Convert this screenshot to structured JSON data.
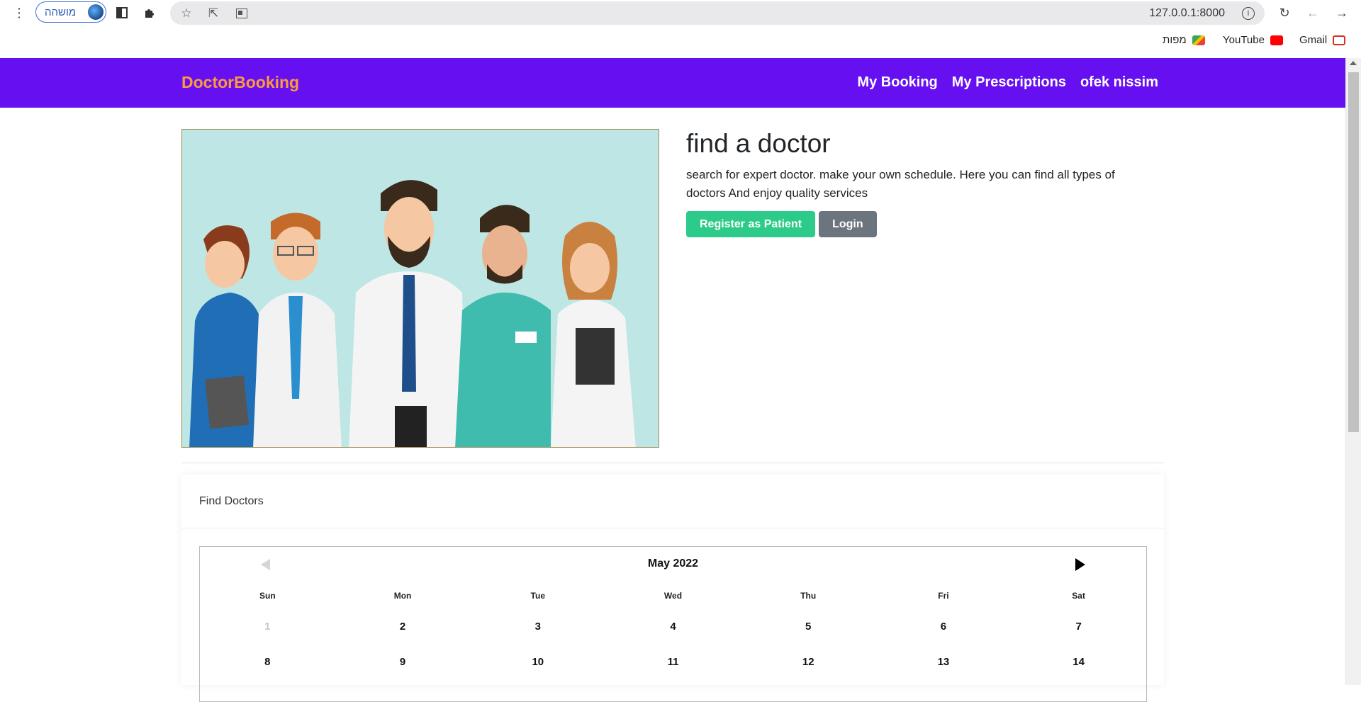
{
  "browser": {
    "profile_label": "מושהה",
    "url": "127.0.0.1:8000",
    "bookmarks": [
      {
        "label": "מפות",
        "icon": "maps-icon"
      },
      {
        "label": "YouTube",
        "icon": "youtube-icon"
      },
      {
        "label": "Gmail",
        "icon": "gmail-icon"
      }
    ]
  },
  "site": {
    "brand": "DoctorBooking",
    "nav": {
      "my_booking": "My Booking",
      "my_prescriptions": "My Prescriptions",
      "user": "ofek nissim"
    },
    "colors": {
      "navbar": "#6610f2",
      "brand": "#fd9a3c",
      "primary_button": "#2dcb8a",
      "secondary_button": "#6c757d"
    }
  },
  "hero": {
    "title": "find a doctor",
    "description": "search for expert doctor. make your own schedule. Here you can find all types of doctors And enjoy quality services",
    "register_button": "Register as Patient",
    "login_button": "Login"
  },
  "find_doctors": {
    "header": "Find Doctors",
    "calendar": {
      "month_label": "May 2022",
      "weekdays": [
        "Sun",
        "Mon",
        "Tue",
        "Wed",
        "Thu",
        "Fri",
        "Sat"
      ],
      "weeks": [
        [
          {
            "d": "1",
            "muted": true
          },
          {
            "d": "2"
          },
          {
            "d": "3"
          },
          {
            "d": "4"
          },
          {
            "d": "5"
          },
          {
            "d": "6"
          },
          {
            "d": "7"
          }
        ],
        [
          {
            "d": "8"
          },
          {
            "d": "9"
          },
          {
            "d": "10"
          },
          {
            "d": "11"
          },
          {
            "d": "12"
          },
          {
            "d": "13"
          },
          {
            "d": "14"
          }
        ]
      ]
    }
  }
}
